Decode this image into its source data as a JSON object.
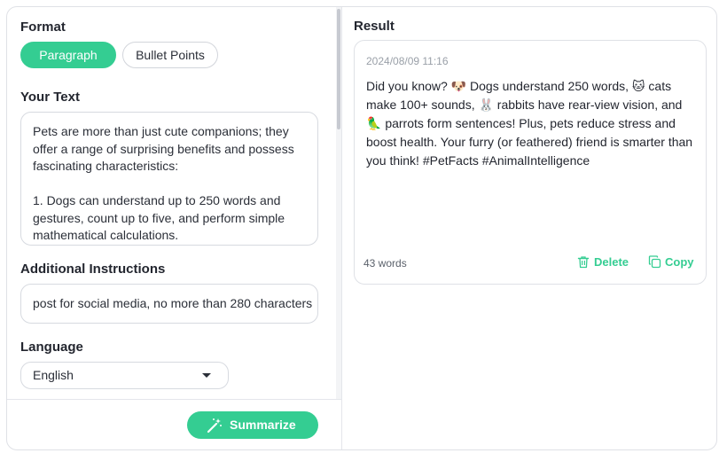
{
  "left": {
    "format": {
      "label": "Format",
      "options": [
        {
          "label": "Paragraph",
          "active": true
        },
        {
          "label": "Bullet Points",
          "active": false
        }
      ]
    },
    "your_text": {
      "label": "Your Text",
      "value": "Pets are more than just cute companions; they offer a range of surprising benefits and possess fascinating characteristics:\n\n1. Dogs can understand up to 250 words and gestures, count up to five, and perform simple mathematical calculations."
    },
    "additional_instructions": {
      "label": "Additional Instructions",
      "value": "post for social media, no more than 280 characters"
    },
    "language": {
      "label": "Language",
      "selected": "English"
    },
    "summarize_label": "Summarize"
  },
  "right": {
    "label": "Result",
    "card": {
      "timestamp": "2024/08/09 11:16",
      "text": "Did you know? 🐶 Dogs understand 250 words, 🐱 cats make 100+ sounds, 🐰 rabbits have rear-view vision, and 🦜 parrots form sentences! Plus, pets reduce stress and boost health. Your furry (or feathered) friend is smarter than you think! #PetFacts #AnimalIntelligence",
      "word_count": "43 words",
      "delete_label": "Delete",
      "copy_label": "Copy"
    }
  },
  "colors": {
    "accent": "#34cd92",
    "border": "#d7dae0",
    "text": "#23262f",
    "muted": "#9aa0a8"
  },
  "icons": {
    "summarize": "magic-wand-icon",
    "delete": "trash-icon",
    "copy": "copy-icon",
    "language": "chevron-down-icon"
  }
}
